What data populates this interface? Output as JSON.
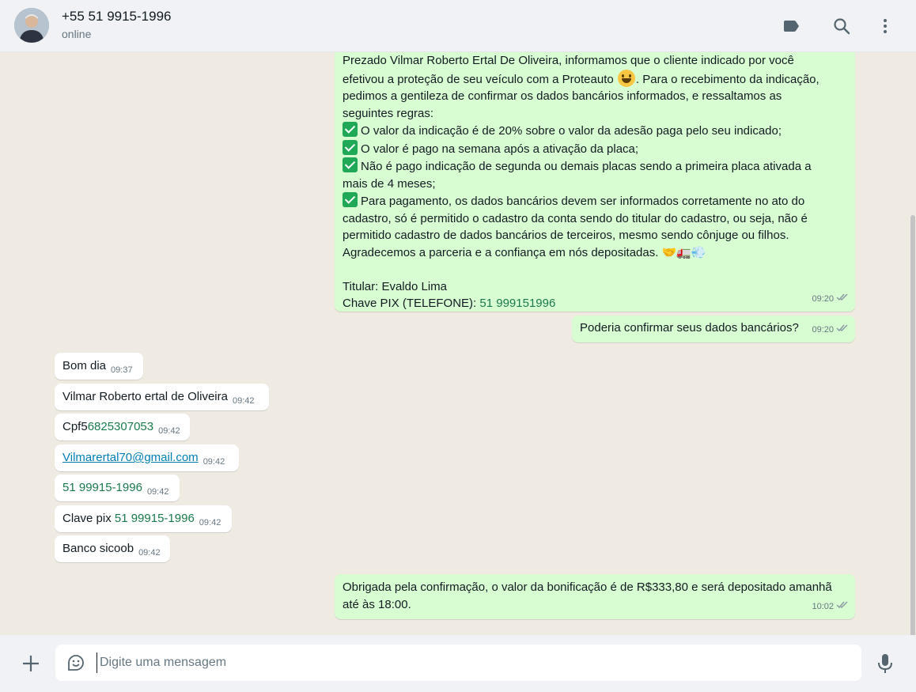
{
  "header": {
    "contact_name": "+55 51 9915-1996",
    "contact_status": "online"
  },
  "icons": {
    "label": "label-icon",
    "search": "search-icon",
    "menu": "more-vertical-icon",
    "attach": "plus-icon",
    "sticker": "sticker-icon",
    "mic": "microphone-icon",
    "read": "double-check-icon"
  },
  "colors": {
    "outgoing_bubble": "#d9fdd3",
    "incoming_bubble": "#ffffff",
    "header_bg": "#f0f2f5",
    "chat_bg": "#efeae2"
  },
  "messages": {
    "m1": {
      "l1": "Prezado Vilmar Roberto Ertal De Oliveira, informamos que o cliente indicado por você",
      "l2a": "efetivou a proteção de seu veículo com a Proteauto ",
      "l2b": ". Para o recebimento da indicação,",
      "l3": "pedimos a gentileza de confirmar os dados bancários informados, e  ressaltamos as",
      "l4": "seguintes regras:",
      "l5": "O valor da indicação é de 20% sobre o valor da adesão paga pelo seu indicado;",
      "l6": "O valor é pago na semana após a ativação da placa;",
      "l7": "Não é pago indicação de segunda ou demais placas sendo a primeira placa ativada a",
      "l8": "mais de 4 meses;",
      "l9": "Para pagamento, os dados bancários devem ser informados corretamente no ato do",
      "l10": "cadastro, só é permitido o cadastro da conta sendo do titular do cadastro, ou seja, não é",
      "l11": "permitido cadastro de dados bancários de terceiros, mesmo sendo cônjuge ou filhos.",
      "l12": "Agradecemos a parceria e a confiança em nós depositadas. 🤝🚛💨",
      "l13": "Titular: Evaldo Lima",
      "l14a": "Chave PIX (TELEFONE): ",
      "l14b": "51 999151996",
      "time": "09:20"
    },
    "m2": {
      "text": "Poderia confirmar seus dados bancários?",
      "time": "09:20"
    },
    "m3": {
      "text": "Bom dia",
      "time": "09:37"
    },
    "m4": {
      "text": "Vilmar Roberto ertal de Oliveira",
      "time": "09:42"
    },
    "m5": {
      "text_a": "Cpf5",
      "text_b": "6825307053",
      "time": "09:42"
    },
    "m6": {
      "text": "Vilmarertal70@gmail.com",
      "time": "09:42"
    },
    "m7": {
      "text": "51 99915-1996",
      "time": "09:42"
    },
    "m8": {
      "text_a": "Clave pix ",
      "text_b": "51 99915-1996",
      "time": "09:42"
    },
    "m9": {
      "text": "Banco sicoob",
      "time": "09:42"
    },
    "m10": {
      "l1": "Obrigada pela confirmação, o valor da bonificação é de R$333,80 e será depositado amanhã",
      "l2": "até às 18:00.",
      "time": "10:02"
    }
  },
  "composer": {
    "placeholder": "Digite uma mensagem"
  }
}
